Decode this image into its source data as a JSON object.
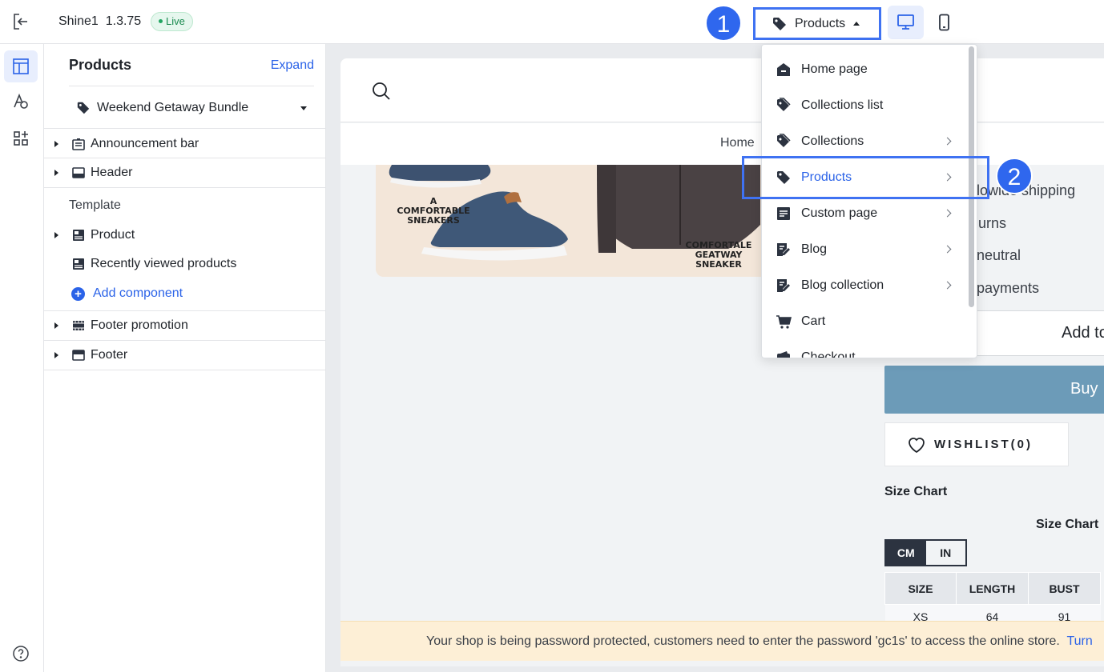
{
  "topbar": {
    "app_name": "Shine1",
    "version": "1.3.75",
    "live_badge": "Live",
    "page_selector_label": "Products"
  },
  "markers": {
    "one": "1",
    "two": "2"
  },
  "sidebar": {
    "title": "Products",
    "expand_label": "Expand",
    "selected_product": "Weekend Getaway Bundle",
    "template_label": "Template",
    "add_component_label": "Add component",
    "sections": [
      {
        "label": "Announcement bar",
        "icon": "announcement-icon"
      },
      {
        "label": "Header",
        "icon": "header-icon"
      },
      {
        "label": "Product",
        "icon": "product-icon"
      },
      {
        "label": "Recently viewed products",
        "icon": "product-icon"
      },
      {
        "label": "Footer promotion",
        "icon": "film-icon"
      },
      {
        "label": "Footer",
        "icon": "footer-icon"
      }
    ]
  },
  "preview": {
    "nav_home": "Home",
    "banner_text_left": "A COMFORTABLE SNEAKERS",
    "banner_text_right": "COMFORTALE GEATWAY SNEAKER",
    "features": [
      "lowide shipping",
      "urns",
      "neutral",
      "payments"
    ],
    "add_to_cart_label": "Add to",
    "buy_label": "Buy",
    "wishlist_label": "WISHLIST(0)",
    "size_chart_label": "Size Chart",
    "size_chart_title": "Size Chart",
    "units": [
      "CM",
      "IN"
    ],
    "table_headers": [
      "SIZE",
      "LENGTH",
      "BUST"
    ],
    "table_row": [
      "XS",
      "64",
      "91"
    ],
    "password_message": "Your shop is being password protected, customers need to enter the password 'gc1s' to access the online store.",
    "password_link": "Turn"
  },
  "dropdown": {
    "items": [
      {
        "label": "Home page",
        "icon": "home-icon",
        "submenu": false
      },
      {
        "label": "Collections list",
        "icon": "tags-icon",
        "submenu": false
      },
      {
        "label": "Collections",
        "icon": "tags-icon",
        "submenu": true
      },
      {
        "label": "Products",
        "icon": "tag-icon",
        "submenu": true
      },
      {
        "label": "Custom page",
        "icon": "page-icon",
        "submenu": true
      },
      {
        "label": "Blog",
        "icon": "blog-icon",
        "submenu": true
      },
      {
        "label": "Blog collection",
        "icon": "blog-icon",
        "submenu": true
      },
      {
        "label": "Cart",
        "icon": "cart-icon",
        "submenu": false
      },
      {
        "label": "Checkout",
        "icon": "wallet-icon",
        "submenu": false
      }
    ]
  },
  "colors": {
    "accent": "#3f72f2",
    "link": "#2b63e8",
    "buy": "#6c9bb8"
  }
}
